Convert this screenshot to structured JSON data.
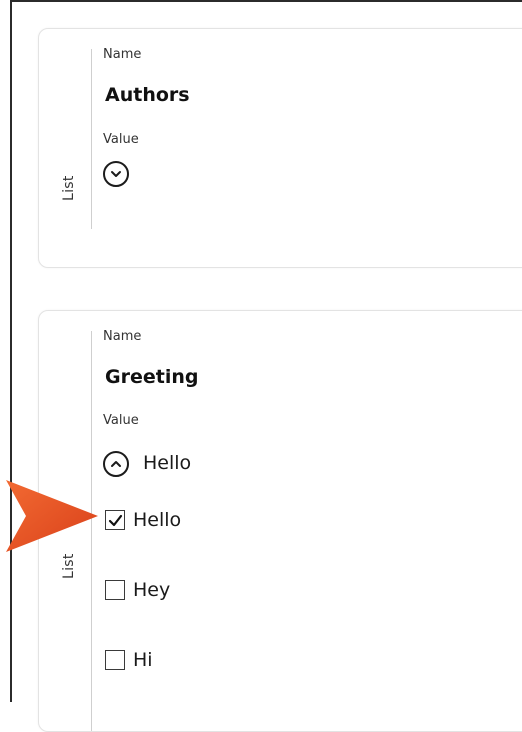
{
  "cards": [
    {
      "side_label": "List",
      "name_label": "Name",
      "name_value": "Authors",
      "value_label": "Value",
      "toggle_icon": "chevron-down-icon"
    },
    {
      "side_label": "List",
      "name_label": "Name",
      "name_value": "Greeting",
      "value_label": "Value",
      "toggle_icon": "chevron-up-icon",
      "selected_value": "Hello",
      "options": [
        {
          "label": "Hello",
          "checked": true
        },
        {
          "label": "Hey",
          "checked": false
        },
        {
          "label": "Hi",
          "checked": false
        }
      ]
    }
  ],
  "colors": {
    "pointer_arrow": "#e8501e",
    "border": "#e3e3e3",
    "text": "#1a1a1a"
  }
}
